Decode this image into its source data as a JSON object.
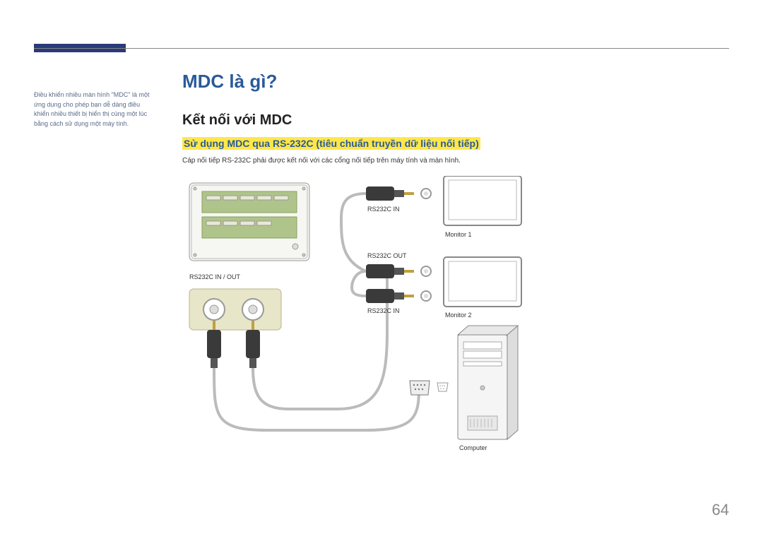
{
  "sidebar_note": "Điều khiển nhiều màn hình \"MDC\" là một ứng dụng cho phép bạn dễ dàng điều khiển nhiều thiết bị hiển thị cùng một lúc bằng cách sử dụng một máy tính.",
  "title": "MDC là gì?",
  "subtitle": "Kết nối với MDC",
  "sub_sub": "Sử dụng MDC qua RS-232C (tiêu chuẩn truyền dữ liệu nối tiếp)",
  "body": "Cáp nối tiếp RS-232C phải được kết nối với các cổng nối tiếp trên máy tính và màn hình.",
  "labels": {
    "port_pair": "RS232C IN / OUT",
    "in1": "RS232C IN",
    "out": "RS232C OUT",
    "in2": "RS232C IN",
    "mon1": "Monitor 1",
    "mon2": "Monitor 2",
    "computer": "Computer"
  },
  "page": "64"
}
